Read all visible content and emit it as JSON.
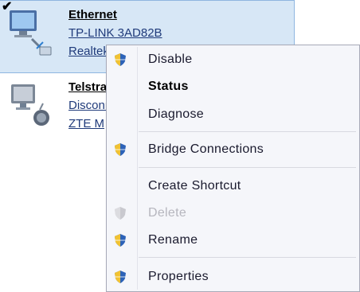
{
  "connections": [
    {
      "name": "Ethernet",
      "lines": [
        "TP-LINK 3AD82B",
        "Realtek"
      ],
      "checked": true,
      "selected": true
    },
    {
      "name": "Telstra",
      "lines": [
        "Disconnected",
        "ZTE M"
      ],
      "checked": false,
      "selected": false
    }
  ],
  "context_menu": {
    "items": [
      {
        "label": "Disable",
        "icon": "uac-shield-icon",
        "bold": false,
        "disabled": false
      },
      {
        "label": "Status",
        "icon": null,
        "bold": true,
        "disabled": false
      },
      {
        "label": "Diagnose",
        "icon": null,
        "bold": false,
        "disabled": false
      },
      {
        "label": "Bridge Connections",
        "icon": "uac-shield-icon",
        "bold": false,
        "disabled": false
      },
      {
        "label": "Create Shortcut",
        "icon": null,
        "bold": false,
        "disabled": false
      },
      {
        "label": "Delete",
        "icon": "uac-shield-icon",
        "bold": false,
        "disabled": true
      },
      {
        "label": "Rename",
        "icon": "uac-shield-icon",
        "bold": false,
        "disabled": false
      },
      {
        "label": "Properties",
        "icon": "uac-shield-icon",
        "bold": false,
        "disabled": false
      }
    ]
  },
  "colors": {
    "selection": "#d7e7f6",
    "selection_border": "#8fb6e0",
    "menu_bg": "#f5f6fa",
    "disabled_text": "#b6b6be"
  }
}
